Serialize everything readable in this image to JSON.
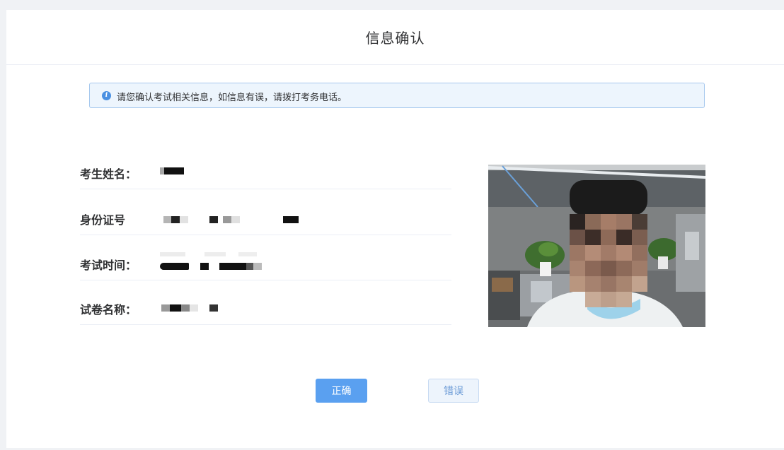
{
  "header": {
    "title": "信息确认"
  },
  "alert": {
    "icon": "info-icon",
    "icon_glyph": "i",
    "message": "请您确认考试相关信息，如信息有误，请拨打考务电话。"
  },
  "fields": [
    {
      "label": "考生姓名：",
      "value_redacted": true
    },
    {
      "label": "身份证号",
      "value_redacted": true
    },
    {
      "label": "考试时间：",
      "value_redacted": true
    },
    {
      "label": "试卷名称：",
      "value_redacted": true
    }
  ],
  "photo": {
    "subject": "examinee-webcam-photo",
    "pixelated": true
  },
  "actions": {
    "confirm_label": "正确",
    "reject_label": "错误"
  },
  "colors": {
    "primary": "#5aa0f0",
    "alert_bg": "#edf5fd",
    "alert_border": "#a6c8ee",
    "text": "#303133"
  }
}
